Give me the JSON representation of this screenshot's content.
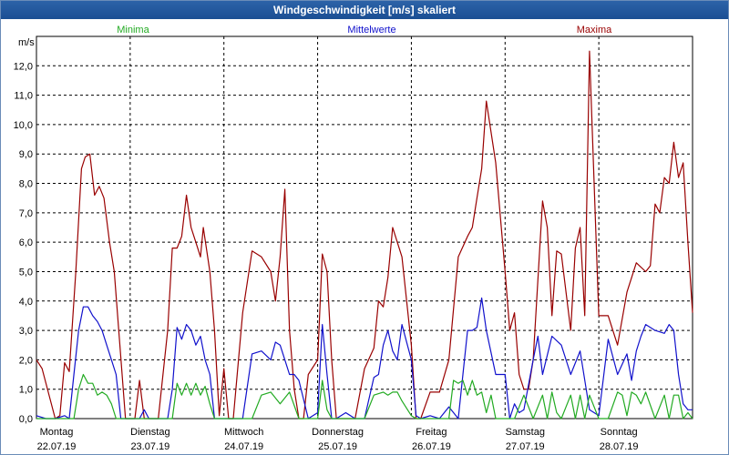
{
  "window": {
    "title": "Windgeschwindigkeit [m/s] skaliert"
  },
  "legend": {
    "min": "Minima",
    "mean": "Mittelwerte",
    "max": "Maxima"
  },
  "colors": {
    "min": "#22aa22",
    "mean": "#1111cc",
    "max": "#990000",
    "grid": "#000000"
  },
  "chart_data": {
    "type": "line",
    "title": "Windgeschwindigkeit [m/s] skaliert",
    "ylabel": "m/s",
    "ylim": [
      0,
      13
    ],
    "yticks": [
      "0,0",
      "1,0",
      "2,0",
      "3,0",
      "4,0",
      "5,0",
      "6,0",
      "7,0",
      "8,0",
      "9,0",
      "10,0",
      "11,0",
      "12,0"
    ],
    "xlim": [
      0,
      7
    ],
    "xticks": [
      {
        "day": "Montag",
        "date": "22.07.19"
      },
      {
        "day": "Dienstag",
        "date": "23.07.19"
      },
      {
        "day": "Mittwoch",
        "date": "24.07.19"
      },
      {
        "day": "Donnerstag",
        "date": "25.07.19"
      },
      {
        "day": "Freitag",
        "date": "26.07.19"
      },
      {
        "day": "Samstag",
        "date": "27.07.19"
      },
      {
        "day": "Sonntag",
        "date": "28.07.19"
      }
    ],
    "grid": true,
    "legend_position": "top",
    "series": [
      {
        "name": "Maxima",
        "x": [
          0.0,
          0.06,
          0.2,
          0.25,
          0.3,
          0.35,
          0.42,
          0.48,
          0.52,
          0.57,
          0.62,
          0.67,
          0.72,
          0.78,
          0.83,
          0.95,
          1.0,
          1.05,
          1.1,
          1.15,
          1.2,
          1.3,
          1.4,
          1.45,
          1.5,
          1.55,
          1.6,
          1.65,
          1.7,
          1.75,
          1.78,
          1.85,
          1.9,
          1.95,
          2.0,
          2.05,
          2.1,
          2.2,
          2.3,
          2.4,
          2.5,
          2.55,
          2.6,
          2.65,
          2.7,
          2.75,
          2.8,
          2.85,
          2.9,
          3.0,
          3.05,
          3.1,
          3.15,
          3.2,
          3.3,
          3.4,
          3.5,
          3.6,
          3.65,
          3.7,
          3.75,
          3.8,
          3.9,
          4.0,
          4.05,
          4.1,
          4.2,
          4.3,
          4.4,
          4.5,
          4.6,
          4.65,
          4.7,
          4.75,
          4.8,
          4.9,
          5.0,
          5.05,
          5.1,
          5.15,
          5.2,
          5.25,
          5.3,
          5.4,
          5.45,
          5.5,
          5.55,
          5.6,
          5.7,
          5.75,
          5.8,
          5.85,
          5.9,
          6.0,
          6.1,
          6.2,
          6.3,
          6.4,
          6.5,
          6.55,
          6.6,
          6.65,
          6.7,
          6.75,
          6.8,
          6.85,
          6.9,
          6.95,
          7.0
        ],
        "values": [
          2.0,
          1.7,
          0.0,
          0.1,
          1.9,
          1.6,
          5.0,
          8.5,
          8.9,
          9.0,
          7.6,
          7.9,
          7.5,
          6.0,
          5.0,
          0.0,
          0.0,
          0.0,
          1.3,
          0.0,
          0.0,
          0.0,
          3.0,
          5.8,
          5.8,
          6.2,
          7.6,
          6.5,
          6.0,
          5.5,
          6.5,
          5.0,
          3.0,
          0.1,
          1.7,
          0.0,
          0.0,
          3.6,
          5.7,
          5.5,
          5.0,
          4.0,
          5.5,
          7.8,
          3.0,
          1.0,
          0.0,
          0.0,
          1.5,
          2.0,
          5.6,
          5.0,
          2.0,
          0.0,
          0.0,
          0.0,
          1.7,
          2.4,
          4.0,
          3.8,
          4.8,
          6.5,
          5.5,
          2.5,
          0.0,
          0.0,
          0.9,
          0.9,
          2.0,
          5.5,
          6.2,
          6.5,
          7.5,
          8.5,
          10.8,
          8.7,
          5.0,
          3.0,
          3.6,
          1.5,
          1.0,
          1.0,
          2.0,
          7.4,
          6.5,
          3.5,
          5.7,
          5.6,
          3.0,
          5.8,
          6.5,
          3.5,
          12.5,
          3.5,
          3.5,
          2.5,
          4.3,
          5.3,
          5.0,
          5.2,
          7.3,
          7.0,
          8.2,
          8.0,
          9.4,
          8.2,
          8.7,
          6.0,
          3.6
        ]
      },
      {
        "name": "Mittelwerte",
        "x": [
          0.0,
          0.1,
          0.2,
          0.3,
          0.35,
          0.4,
          0.45,
          0.5,
          0.55,
          0.6,
          0.65,
          0.7,
          0.75,
          0.8,
          0.85,
          0.9,
          1.0,
          1.1,
          1.15,
          1.2,
          1.3,
          1.4,
          1.45,
          1.5,
          1.55,
          1.6,
          1.65,
          1.7,
          1.75,
          1.8,
          1.85,
          1.9,
          2.0,
          2.1,
          2.2,
          2.3,
          2.4,
          2.5,
          2.55,
          2.6,
          2.65,
          2.7,
          2.75,
          2.8,
          2.9,
          3.0,
          3.05,
          3.1,
          3.15,
          3.2,
          3.3,
          3.4,
          3.5,
          3.6,
          3.65,
          3.7,
          3.75,
          3.8,
          3.85,
          3.9,
          4.0,
          4.05,
          4.1,
          4.2,
          4.3,
          4.4,
          4.5,
          4.55,
          4.6,
          4.65,
          4.7,
          4.75,
          4.8,
          4.9,
          5.0,
          5.05,
          5.1,
          5.15,
          5.2,
          5.3,
          5.35,
          5.4,
          5.5,
          5.6,
          5.7,
          5.8,
          5.9,
          6.0,
          6.1,
          6.2,
          6.3,
          6.35,
          6.4,
          6.45,
          6.5,
          6.6,
          6.7,
          6.75,
          6.8,
          6.85,
          6.9,
          6.95,
          7.0
        ],
        "values": [
          0.1,
          0.0,
          0.0,
          0.1,
          0.0,
          1.5,
          3.0,
          3.8,
          3.8,
          3.5,
          3.3,
          3.0,
          2.5,
          2.0,
          1.5,
          0.0,
          0.0,
          0.0,
          0.3,
          0.0,
          0.0,
          0.0,
          1.0,
          3.1,
          2.7,
          3.2,
          3.0,
          2.5,
          2.8,
          2.0,
          1.5,
          0.0,
          0.0,
          0.0,
          0.0,
          2.2,
          2.3,
          2.0,
          2.6,
          2.5,
          2.0,
          1.5,
          1.5,
          1.3,
          0.0,
          0.2,
          3.2,
          1.5,
          0.0,
          0.0,
          0.2,
          0.0,
          0.0,
          1.4,
          1.5,
          2.5,
          3.0,
          2.3,
          2.0,
          3.2,
          2.0,
          0.1,
          0.0,
          0.1,
          0.0,
          0.4,
          0.0,
          1.5,
          3.0,
          3.0,
          3.1,
          4.1,
          3.0,
          1.5,
          1.5,
          0.0,
          0.5,
          0.2,
          0.3,
          2.0,
          2.8,
          1.5,
          2.8,
          2.5,
          1.5,
          2.3,
          0.3,
          0.1,
          2.7,
          1.5,
          2.2,
          1.3,
          2.3,
          2.8,
          3.2,
          3.0,
          2.9,
          3.2,
          3.0,
          1.5,
          0.5,
          0.3,
          0.3
        ]
      },
      {
        "name": "Minima",
        "x": [
          0.0,
          0.2,
          0.3,
          0.4,
          0.45,
          0.5,
          0.55,
          0.6,
          0.65,
          0.7,
          0.75,
          0.8,
          0.85,
          0.9,
          1.0,
          1.3,
          1.4,
          1.45,
          1.5,
          1.55,
          1.6,
          1.65,
          1.7,
          1.75,
          1.8,
          1.85,
          1.9,
          2.0,
          2.1,
          2.2,
          2.3,
          2.4,
          2.5,
          2.6,
          2.7,
          2.8,
          2.9,
          3.0,
          3.05,
          3.1,
          3.15,
          3.2,
          3.3,
          3.4,
          3.5,
          3.6,
          3.7,
          3.75,
          3.8,
          3.85,
          3.9,
          4.0,
          4.05,
          4.1,
          4.3,
          4.4,
          4.45,
          4.5,
          4.55,
          4.6,
          4.65,
          4.7,
          4.75,
          4.8,
          4.85,
          4.9,
          5.0,
          5.1,
          5.2,
          5.3,
          5.4,
          5.45,
          5.5,
          5.55,
          5.6,
          5.7,
          5.75,
          5.8,
          5.85,
          5.9,
          6.0,
          6.1,
          6.2,
          6.25,
          6.3,
          6.35,
          6.4,
          6.45,
          6.5,
          6.6,
          6.7,
          6.75,
          6.8,
          6.85,
          6.9,
          6.95,
          7.0
        ],
        "values": [
          0.0,
          0.0,
          0.0,
          0.0,
          1.0,
          1.5,
          1.2,
          1.2,
          0.8,
          0.9,
          0.8,
          0.5,
          0.0,
          0.0,
          0.0,
          0.0,
          0.0,
          0.0,
          1.2,
          0.8,
          1.2,
          0.8,
          1.2,
          0.8,
          1.1,
          0.5,
          0.0,
          0.0,
          0.0,
          0.0,
          0.0,
          0.8,
          0.9,
          0.5,
          0.9,
          0.0,
          0.0,
          0.0,
          1.3,
          0.3,
          0.0,
          0.0,
          0.0,
          0.0,
          0.0,
          0.8,
          0.9,
          0.8,
          0.9,
          0.9,
          0.6,
          0.1,
          0.0,
          0.0,
          0.0,
          0.0,
          1.3,
          1.2,
          1.3,
          0.8,
          1.3,
          0.8,
          0.9,
          0.2,
          0.8,
          0.0,
          0.0,
          0.0,
          0.8,
          0.0,
          0.8,
          0.0,
          0.9,
          0.2,
          0.0,
          0.8,
          0.0,
          0.8,
          0.0,
          0.8,
          0.0,
          0.0,
          0.9,
          0.8,
          0.1,
          0.9,
          0.8,
          0.5,
          0.9,
          0.0,
          0.8,
          0.0,
          0.8,
          0.8,
          0.0,
          0.2,
          0.0
        ]
      }
    ]
  }
}
